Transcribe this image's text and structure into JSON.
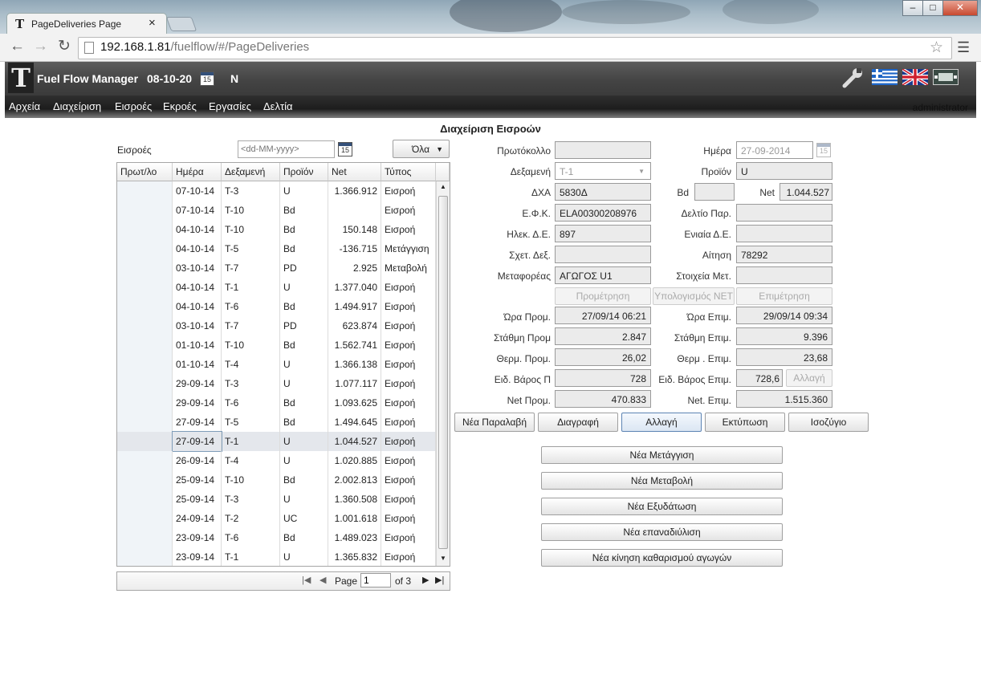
{
  "browser": {
    "tab_title": "PageDeliveries Page",
    "tab_close": "×",
    "url_host": "192.168.1.81",
    "url_path": "/fuelflow/#/PageDeliveries"
  },
  "app": {
    "logo": "T",
    "title": "Fuel Flow Manager",
    "date": "08-10-20",
    "calendar_day": "15",
    "indicator": "N",
    "user": "administrator"
  },
  "menu": [
    "Αρχεία",
    "Διαχείριση",
    "Εισροές",
    "Εκροές",
    "Εργασίες",
    "Δελτία"
  ],
  "page_title": "Διαχείριση Εισροών",
  "filter": {
    "label": "Εισροές",
    "date_placeholder": "<dd-MM-yyyy>",
    "calendar_day": "15",
    "select_value": "Όλα"
  },
  "grid": {
    "columns": [
      "Πρωτ/λο",
      "Ημέρα",
      "Δεξαμενή",
      "Προϊόν",
      "Net",
      "Τύπος"
    ],
    "rows": [
      [
        "",
        "07-10-14",
        "T-3",
        "U",
        "1.366.912",
        "Εισροή"
      ],
      [
        "",
        "07-10-14",
        "T-10",
        "Bd",
        "",
        "Εισροή"
      ],
      [
        "",
        "04-10-14",
        "T-10",
        "Bd",
        "150.148",
        "Εισροή"
      ],
      [
        "",
        "04-10-14",
        "T-5",
        "Bd",
        "-136.715",
        "Μετάγγιση"
      ],
      [
        "",
        "03-10-14",
        "T-7",
        "PD",
        "2.925",
        "Μεταβολή"
      ],
      [
        "",
        "04-10-14",
        "T-1",
        "U",
        "1.377.040",
        "Εισροή"
      ],
      [
        "",
        "04-10-14",
        "T-6",
        "Bd",
        "1.494.917",
        "Εισροή"
      ],
      [
        "",
        "03-10-14",
        "T-7",
        "PD",
        "623.874",
        "Εισροή"
      ],
      [
        "",
        "01-10-14",
        "T-10",
        "Bd",
        "1.562.741",
        "Εισροή"
      ],
      [
        "",
        "01-10-14",
        "T-4",
        "U",
        "1.366.138",
        "Εισροή"
      ],
      [
        "",
        "29-09-14",
        "T-3",
        "U",
        "1.077.117",
        "Εισροή"
      ],
      [
        "",
        "29-09-14",
        "T-6",
        "Bd",
        "1.093.625",
        "Εισροή"
      ],
      [
        "",
        "27-09-14",
        "T-5",
        "Bd",
        "1.494.645",
        "Εισροή"
      ],
      [
        "",
        "27-09-14",
        "T-1",
        "U",
        "1.044.527",
        "Εισροή"
      ],
      [
        "",
        "26-09-14",
        "T-4",
        "U",
        "1.020.885",
        "Εισροή"
      ],
      [
        "",
        "25-09-14",
        "T-10",
        "Bd",
        "2.002.813",
        "Εισροή"
      ],
      [
        "",
        "25-09-14",
        "T-3",
        "U",
        "1.360.508",
        "Εισροή"
      ],
      [
        "",
        "24-09-14",
        "T-2",
        "UC",
        "1.001.618",
        "Εισροή"
      ],
      [
        "",
        "23-09-14",
        "T-6",
        "Bd",
        "1.489.023",
        "Εισροή"
      ],
      [
        "",
        "23-09-14",
        "T-1",
        "U",
        "1.365.832",
        "Εισροή"
      ]
    ],
    "selected_row": 13
  },
  "pager": {
    "page_label": "Page",
    "page_value": "1",
    "of_label": "of 3"
  },
  "form": {
    "protocol": {
      "label": "Πρωτόκολλο",
      "value": ""
    },
    "day": {
      "label": "Ημέρα",
      "value": "27-09-2014",
      "calendar_day": "15"
    },
    "tank": {
      "label": "Δεξαμενή",
      "value": "T-1"
    },
    "product": {
      "label": "Προϊόν",
      "value": "U"
    },
    "dxa": {
      "label": "ΔΧΑ",
      "value": "5830Δ"
    },
    "bd": {
      "label": "Bd",
      "value": ""
    },
    "net": {
      "label": "Net",
      "value": "1.044.527"
    },
    "efk": {
      "label": "Ε.Φ.Κ.",
      "value": "ELA00300208976"
    },
    "delivery_note": {
      "label": "Δελτίο Παρ.",
      "value": ""
    },
    "elec_de": {
      "label": "Ηλεκ. Δ.Ε.",
      "value": "897"
    },
    "unified_de": {
      "label": "Ενιαία Δ.Ε.",
      "value": ""
    },
    "rel_tank": {
      "label": "Σχετ. Δεξ.",
      "value": ""
    },
    "request": {
      "label": "Αίτηση",
      "value": "78292"
    },
    "carrier": {
      "label": "Μεταφορέας",
      "value": "ΑΓΩΓΟΣ U1"
    },
    "transport_info": {
      "label": "Στοιχεία Μετ.",
      "value": ""
    },
    "btn_premeasure": "Προμέτρηση",
    "btn_calc_net": "Υπολογισμός NET",
    "btn_remeasure": "Επιμέτρηση",
    "time_pre": {
      "label": "Ώρα Προμ.",
      "value": "27/09/14 06:21"
    },
    "time_post": {
      "label": "Ώρα Επιμ.",
      "value": "29/09/14 09:34"
    },
    "level_pre": {
      "label": "Στάθμη Προμ",
      "value": "2.847"
    },
    "level_post": {
      "label": "Στάθμη Επιμ.",
      "value": "9.396"
    },
    "temp_pre": {
      "label": "Θερμ. Προμ.",
      "value": "26,02"
    },
    "temp_post": {
      "label": "Θερμ . Επιμ.",
      "value": "23,68"
    },
    "density_pre": {
      "label": "Ειδ. Βάρος Π",
      "value": "728"
    },
    "density_post": {
      "label": "Ειδ. Βάρος Επιμ.",
      "value": "728,6"
    },
    "btn_change_small": "Αλλαγή",
    "net_pre": {
      "label": "Net Προμ.",
      "value": "470.833"
    },
    "net_post": {
      "label": "Net. Επιμ.",
      "value": "1.515.360"
    }
  },
  "actions": [
    "Νέα Παραλαβή",
    "Διαγραφή",
    "Αλλαγή",
    "Εκτύπωση",
    "Ισοζύγιο"
  ],
  "new_actions": [
    "Νέα Μετάγγιση",
    "Νέα Μεταβολή",
    "Νέα Εξυδάτωση",
    "Νέα επαναδιύλιση",
    "Νέα κίνηση καθαρισμού αγωγών"
  ],
  "colors": {
    "header_dark": "#444444",
    "menu_dark": "#1d1d1d",
    "selected_row": "#e4e7ec",
    "alt_row": "#f0f4f8"
  }
}
